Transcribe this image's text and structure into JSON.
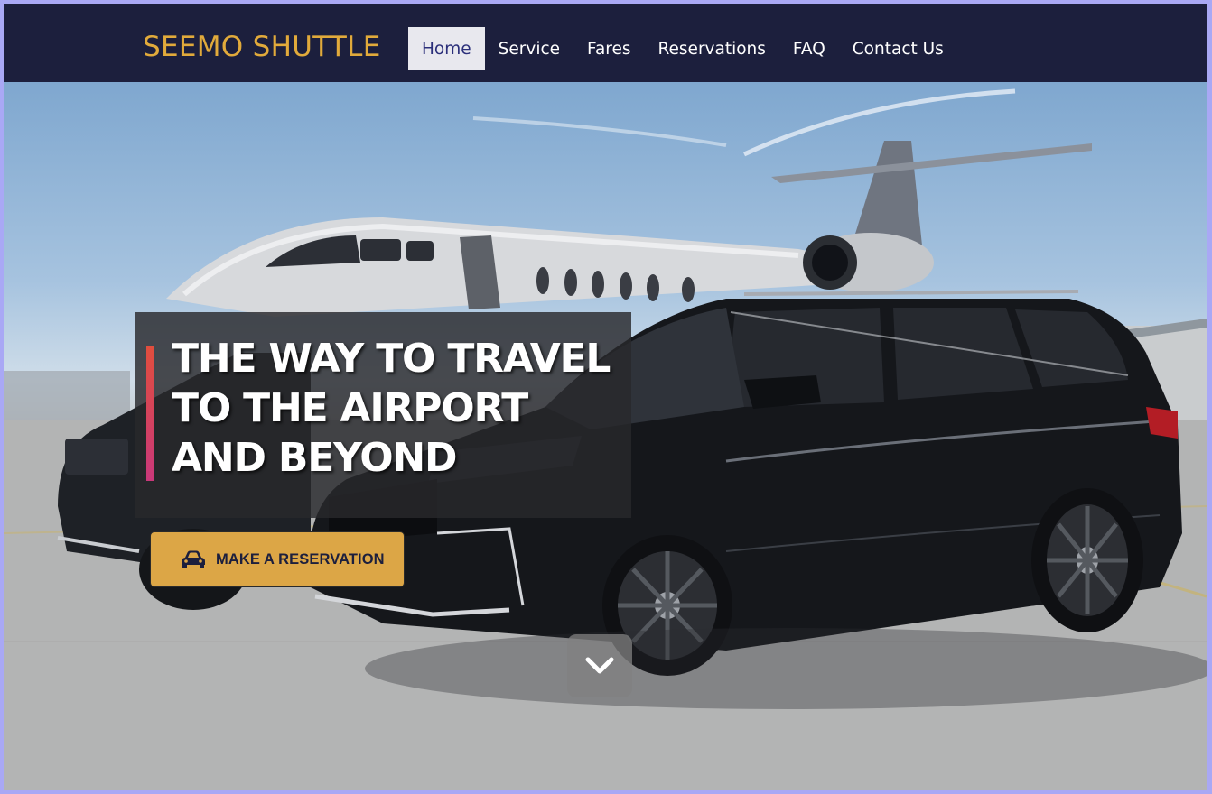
{
  "header": {
    "brand": "SEEMO SHUTTLE",
    "nav": [
      {
        "label": "Home",
        "active": true
      },
      {
        "label": "Service",
        "active": false
      },
      {
        "label": "Fares",
        "active": false
      },
      {
        "label": "Reservations",
        "active": false
      },
      {
        "label": "FAQ",
        "active": false
      },
      {
        "label": "Contact Us",
        "active": false
      }
    ]
  },
  "hero": {
    "image": "black SUVs parked in front of a private jet on an airport tarmac",
    "headline_lines": [
      "THE WAY TO TRAVEL",
      "TO THE AIRPORT",
      "AND BEYOND"
    ],
    "cta": {
      "label": "MAKE A RESERVATION",
      "icon": "car-icon"
    },
    "scroll_icon": "chevron-down-icon"
  },
  "colors": {
    "header_bg": "#1c1f3d",
    "brand": "#e1aa3b",
    "cta_bg": "#dca646",
    "accent_bar": "#d9434f",
    "active_nav_bg": "#e8e8ee",
    "active_nav_text": "#2b2f7a"
  }
}
